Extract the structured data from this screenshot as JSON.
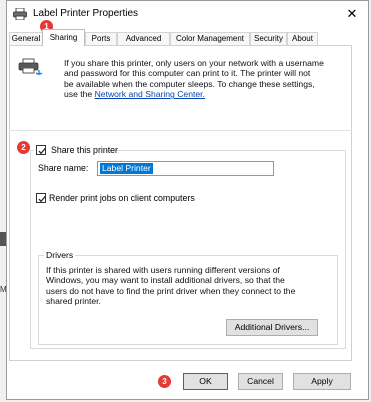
{
  "window": {
    "title": "Label Printer Properties",
    "close_symbol": "✕"
  },
  "tabs": [
    {
      "label": "General"
    },
    {
      "label": "Sharing"
    },
    {
      "label": "Ports"
    },
    {
      "label": "Advanced"
    },
    {
      "label": "Color Management"
    },
    {
      "label": "Security"
    },
    {
      "label": "About"
    }
  ],
  "info": {
    "line1": "If you share this printer, only users on your network with a username",
    "line2": "and password for this computer can print to it. The printer will not",
    "line3": "be available when the computer sleeps. To change these settings,",
    "line4_prefix": "use the ",
    "link": "Network and Sharing Center.",
    "icon": "network-printer-icon"
  },
  "share": {
    "checkbox_label": "Share this printer",
    "checked": true,
    "name_label": "Share name:",
    "name_value": "Label Printer",
    "render_label": "Render print jobs on client computers",
    "render_checked": true
  },
  "drivers": {
    "legend": "Drivers",
    "line1": "If this printer is shared with users running different versions of",
    "line2": "Windows, you may want to install additional drivers, so that the",
    "line3": "users do not have to find the print driver when they connect to the",
    "line4": "shared printer.",
    "button": "Additional Drivers..."
  },
  "footer": {
    "ok": "OK",
    "cancel": "Cancel",
    "apply": "Apply"
  },
  "badges": {
    "b1": "1",
    "b2": "2",
    "b3": "3"
  },
  "colors": {
    "badge": "#e53935",
    "accent": "#0078d7",
    "link": "#0645ad"
  }
}
